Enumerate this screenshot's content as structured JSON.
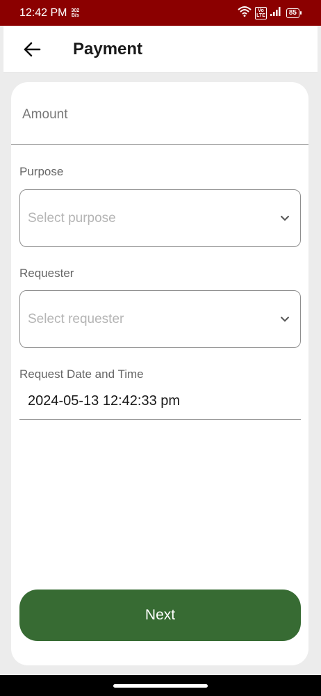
{
  "status_bar": {
    "time": "12:42 PM",
    "net_speed_value": "302",
    "net_speed_unit": "B/s",
    "volte_top": "Vo",
    "volte_bottom": "LTE",
    "battery": "85"
  },
  "app_bar": {
    "title": "Payment"
  },
  "form": {
    "amount_placeholder": "Amount",
    "purpose_label": "Purpose",
    "purpose_placeholder": "Select purpose",
    "requester_label": "Requester",
    "requester_placeholder": "Select requester",
    "date_label": "Request Date and Time",
    "date_value": "2024-05-13 12:42:33 pm"
  },
  "actions": {
    "next_label": "Next"
  },
  "colors": {
    "status_bar": "#8b0000",
    "primary_button": "#376b33",
    "background": "#ececec"
  }
}
